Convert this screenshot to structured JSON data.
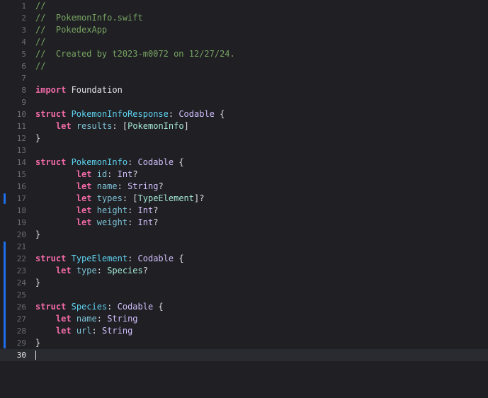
{
  "editor": {
    "current_line": 30,
    "change_bars": [
      17,
      21,
      22,
      23,
      24,
      25,
      26,
      27,
      28,
      29
    ],
    "lines": [
      {
        "num": "1",
        "tokens": [
          {
            "t": "//",
            "k": "comment"
          }
        ]
      },
      {
        "num": "2",
        "tokens": [
          {
            "t": "//  PokemonInfo.swift",
            "k": "comment"
          }
        ]
      },
      {
        "num": "3",
        "tokens": [
          {
            "t": "//  PokedexApp",
            "k": "comment"
          }
        ]
      },
      {
        "num": "4",
        "tokens": [
          {
            "t": "//",
            "k": "comment"
          }
        ]
      },
      {
        "num": "5",
        "tokens": [
          {
            "t": "//  Created by t2023-m0072 on 12/27/24.",
            "k": "comment"
          }
        ]
      },
      {
        "num": "6",
        "tokens": [
          {
            "t": "//",
            "k": "comment"
          }
        ]
      },
      {
        "num": "7",
        "tokens": []
      },
      {
        "num": "8",
        "tokens": [
          {
            "t": "import",
            "k": "keyword"
          },
          {
            "t": " Foundation",
            "k": "plain"
          }
        ]
      },
      {
        "num": "9",
        "tokens": []
      },
      {
        "num": "10",
        "tokens": [
          {
            "t": "struct",
            "k": "keyword"
          },
          {
            "t": " ",
            "k": "plain"
          },
          {
            "t": "PokemonInfoResponse",
            "k": "typedecl"
          },
          {
            "t": ": ",
            "k": "plain"
          },
          {
            "t": "Codable",
            "k": "type"
          },
          {
            "t": " {",
            "k": "plain"
          }
        ]
      },
      {
        "num": "11",
        "tokens": [
          {
            "t": "    ",
            "k": "plain"
          },
          {
            "t": "let",
            "k": "keyword"
          },
          {
            "t": " ",
            "k": "plain"
          },
          {
            "t": "results",
            "k": "prop"
          },
          {
            "t": ": [",
            "k": "plain"
          },
          {
            "t": "PokemonInfo",
            "k": "typeref"
          },
          {
            "t": "]",
            "k": "plain"
          }
        ]
      },
      {
        "num": "12",
        "tokens": [
          {
            "t": "}",
            "k": "plain"
          }
        ]
      },
      {
        "num": "13",
        "tokens": []
      },
      {
        "num": "14",
        "tokens": [
          {
            "t": "struct",
            "k": "keyword"
          },
          {
            "t": " ",
            "k": "plain"
          },
          {
            "t": "PokemonInfo",
            "k": "typedecl"
          },
          {
            "t": ": ",
            "k": "plain"
          },
          {
            "t": "Codable",
            "k": "type"
          },
          {
            "t": " {",
            "k": "plain"
          }
        ]
      },
      {
        "num": "15",
        "tokens": [
          {
            "t": "        ",
            "k": "plain"
          },
          {
            "t": "let",
            "k": "keyword"
          },
          {
            "t": " ",
            "k": "plain"
          },
          {
            "t": "id",
            "k": "prop"
          },
          {
            "t": ": ",
            "k": "plain"
          },
          {
            "t": "Int",
            "k": "type"
          },
          {
            "t": "?",
            "k": "plain"
          }
        ]
      },
      {
        "num": "16",
        "tokens": [
          {
            "t": "        ",
            "k": "plain"
          },
          {
            "t": "let",
            "k": "keyword"
          },
          {
            "t": " ",
            "k": "plain"
          },
          {
            "t": "name",
            "k": "prop"
          },
          {
            "t": ": ",
            "k": "plain"
          },
          {
            "t": "String",
            "k": "type"
          },
          {
            "t": "?",
            "k": "plain"
          }
        ]
      },
      {
        "num": "17",
        "tokens": [
          {
            "t": "        ",
            "k": "plain"
          },
          {
            "t": "let",
            "k": "keyword"
          },
          {
            "t": " ",
            "k": "plain"
          },
          {
            "t": "types",
            "k": "prop"
          },
          {
            "t": ": [",
            "k": "plain"
          },
          {
            "t": "TypeElement",
            "k": "typeref"
          },
          {
            "t": "]?",
            "k": "plain"
          }
        ]
      },
      {
        "num": "18",
        "tokens": [
          {
            "t": "        ",
            "k": "plain"
          },
          {
            "t": "let",
            "k": "keyword"
          },
          {
            "t": " ",
            "k": "plain"
          },
          {
            "t": "height",
            "k": "prop"
          },
          {
            "t": ": ",
            "k": "plain"
          },
          {
            "t": "Int",
            "k": "type"
          },
          {
            "t": "?",
            "k": "plain"
          }
        ]
      },
      {
        "num": "19",
        "tokens": [
          {
            "t": "        ",
            "k": "plain"
          },
          {
            "t": "let",
            "k": "keyword"
          },
          {
            "t": " ",
            "k": "plain"
          },
          {
            "t": "weight",
            "k": "prop"
          },
          {
            "t": ": ",
            "k": "plain"
          },
          {
            "t": "Int",
            "k": "type"
          },
          {
            "t": "?",
            "k": "plain"
          }
        ]
      },
      {
        "num": "20",
        "tokens": [
          {
            "t": "}",
            "k": "plain"
          }
        ]
      },
      {
        "num": "21",
        "tokens": []
      },
      {
        "num": "22",
        "tokens": [
          {
            "t": "struct",
            "k": "keyword"
          },
          {
            "t": " ",
            "k": "plain"
          },
          {
            "t": "TypeElement",
            "k": "typedecl"
          },
          {
            "t": ": ",
            "k": "plain"
          },
          {
            "t": "Codable",
            "k": "type"
          },
          {
            "t": " {",
            "k": "plain"
          }
        ]
      },
      {
        "num": "23",
        "tokens": [
          {
            "t": "    ",
            "k": "plain"
          },
          {
            "t": "let",
            "k": "keyword"
          },
          {
            "t": " ",
            "k": "plain"
          },
          {
            "t": "type",
            "k": "prop"
          },
          {
            "t": ": ",
            "k": "plain"
          },
          {
            "t": "Species",
            "k": "typeref"
          },
          {
            "t": "?",
            "k": "plain"
          }
        ]
      },
      {
        "num": "24",
        "tokens": [
          {
            "t": "}",
            "k": "plain"
          }
        ]
      },
      {
        "num": "25",
        "tokens": []
      },
      {
        "num": "26",
        "tokens": [
          {
            "t": "struct",
            "k": "keyword"
          },
          {
            "t": " ",
            "k": "plain"
          },
          {
            "t": "Species",
            "k": "typedecl"
          },
          {
            "t": ": ",
            "k": "plain"
          },
          {
            "t": "Codable",
            "k": "type"
          },
          {
            "t": " {",
            "k": "plain"
          }
        ]
      },
      {
        "num": "27",
        "tokens": [
          {
            "t": "    ",
            "k": "plain"
          },
          {
            "t": "let",
            "k": "keyword"
          },
          {
            "t": " ",
            "k": "plain"
          },
          {
            "t": "name",
            "k": "prop"
          },
          {
            "t": ": ",
            "k": "plain"
          },
          {
            "t": "String",
            "k": "type"
          }
        ]
      },
      {
        "num": "28",
        "tokens": [
          {
            "t": "    ",
            "k": "plain"
          },
          {
            "t": "let",
            "k": "keyword"
          },
          {
            "t": " ",
            "k": "plain"
          },
          {
            "t": "url",
            "k": "prop"
          },
          {
            "t": ": ",
            "k": "plain"
          },
          {
            "t": "String",
            "k": "type"
          }
        ]
      },
      {
        "num": "29",
        "tokens": [
          {
            "t": "}",
            "k": "plain"
          }
        ]
      },
      {
        "num": "30",
        "tokens": []
      }
    ]
  }
}
